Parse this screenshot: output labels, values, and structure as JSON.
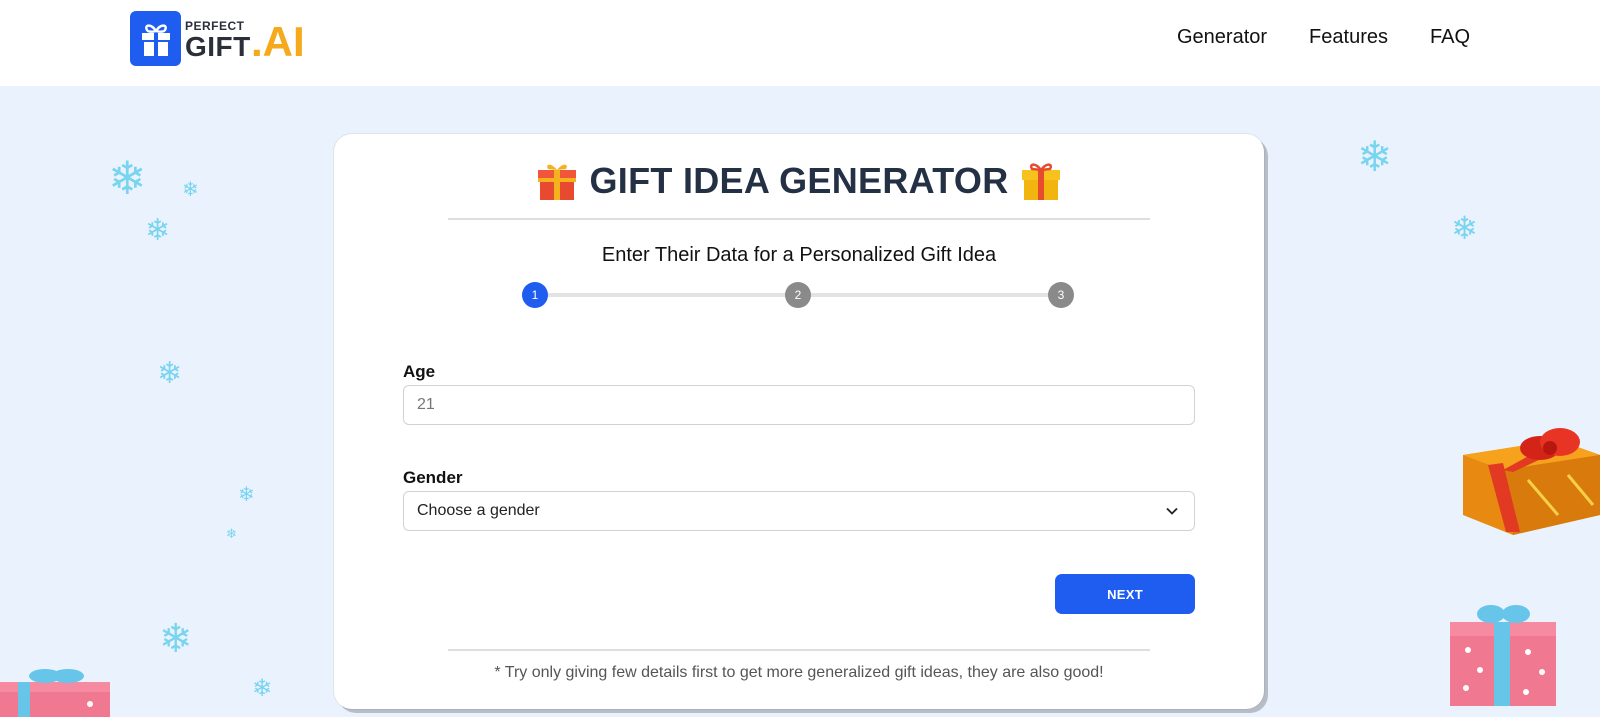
{
  "brand": {
    "perfect": "PERFECT",
    "gift": "GIFT",
    "ai": ".AI"
  },
  "nav": {
    "items": [
      "Generator",
      "Features",
      "FAQ"
    ]
  },
  "card": {
    "title": "GIFT IDEA GENERATOR",
    "subtitle": "Enter Their Data for a Personalized Gift Idea",
    "steps": [
      "1",
      "2",
      "3"
    ],
    "active_step": 1,
    "age": {
      "label": "Age",
      "placeholder": "21"
    },
    "gender": {
      "label": "Gender",
      "selected": "Choose a gender"
    },
    "next_label": "NEXT",
    "footnote": "* Try only giving few details first to get more generalized gift ideas, they are also good!"
  },
  "colors": {
    "accent": "#1f5cf0",
    "ai": "#f5a91b",
    "background": "#eaf3fd"
  },
  "icons": [
    "gift-box-icon",
    "gift-icon",
    "snowflake-icon",
    "chevron-down-icon"
  ]
}
